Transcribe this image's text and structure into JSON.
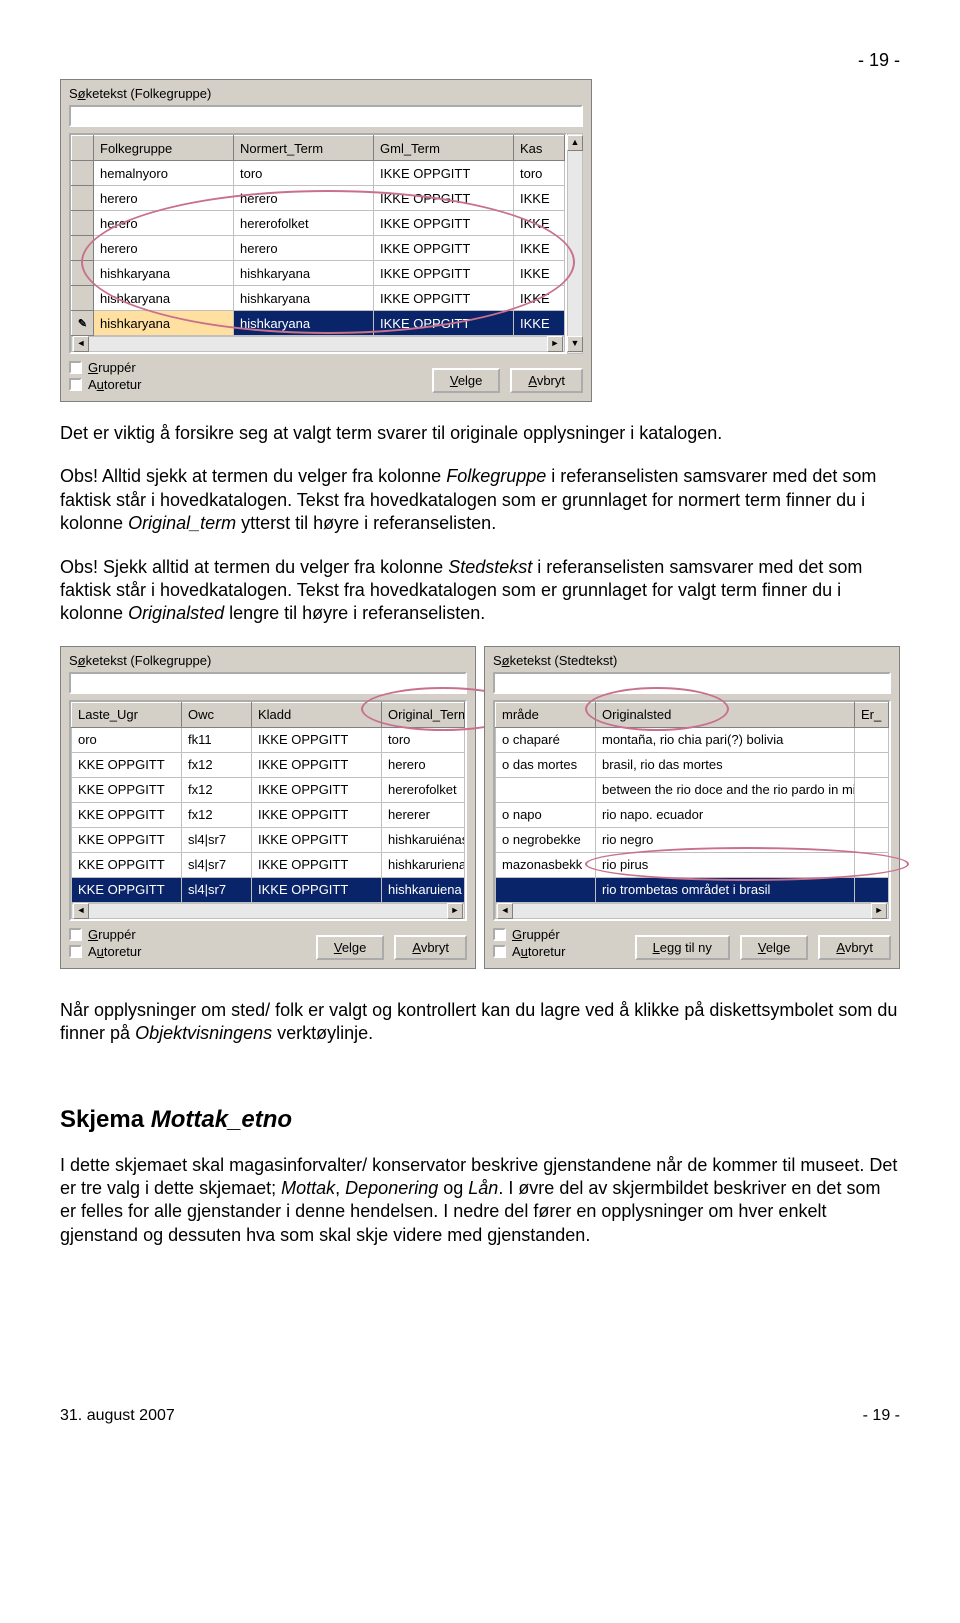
{
  "page": {
    "header_right": "- 19 -",
    "footer_left": "31. august 2007",
    "footer_right": "- 19 -"
  },
  "body": {
    "p1": "Det er viktig å forsikre seg at valgt term svarer til originale opplysninger i katalogen.",
    "p2a": "Obs! Alltid sjekk at termen du velger fra kolonne ",
    "p2_em1": "Folkegruppe",
    "p2b": " i referanselisten samsvarer med det som faktisk står i hovedkatalogen. Tekst fra hovedkatalogen som er grunnlaget for normert term finner du i kolonne ",
    "p2_em2": "Original_term",
    "p2c": " ytterst til høyre i referanselisten.",
    "p3a": "Obs! Sjekk alltid at termen du velger fra kolonne ",
    "p3_em1": "Stedstekst",
    "p3b": " i referanselisten samsvarer med det som faktisk står i hovedkatalogen. Tekst fra hovedkatalogen som er grunnlaget for valgt term finner du i kolonne ",
    "p3_em2": "Originalsted",
    "p3c": " lengre til høyre i referanselisten.",
    "p4a": "Når opplysninger om sted/ folk er valgt og kontrollert kan du lagre ved å klikke på diskettsymbolet som du finner på ",
    "p4_em1": "Objektvisningens",
    "p4b": " verktøylinje.",
    "h2a": "Skjema ",
    "h2_em": "Mottak_etno",
    "p5a": "I dette skjemaet skal magasinforvalter/ konservator beskrive gjenstandene når de kommer til museet. Det er tre valg i dette skjemaet; ",
    "p5_em1": "Mottak",
    "p5b": ", ",
    "p5_em2": "Deponering",
    "p5c": " og ",
    "p5_em3": "Lån",
    "p5d": ". I øvre del av skjermbildet beskriver en det som er felles for alle gjenstander i denne hendelsen. I nedre del fører en opplysninger om hver enkelt gjenstand og dessuten hva som skal skje videre med gjenstanden."
  },
  "panel1": {
    "label_pre": "S",
    "label_u": "ø",
    "label_post": "ketekst (Folkegruppe)",
    "cols": {
      "c1": "Folkegruppe",
      "c2": "Normert_Term",
      "c3": "Gml_Term",
      "c4": "Kas"
    },
    "rows": [
      {
        "c1": "hemalnyoro",
        "c2": "toro",
        "c3": "IKKE OPPGITT",
        "c4": "toro"
      },
      {
        "c1": "herero",
        "c2": "herero",
        "c3": "IKKE OPPGITT",
        "c4": "IKKE"
      },
      {
        "c1": "herero",
        "c2": "hererofolket",
        "c3": "IKKE OPPGITT",
        "c4": "IKKE"
      },
      {
        "c1": "herero",
        "c2": "herero",
        "c3": "IKKE OPPGITT",
        "c4": "IKKE"
      },
      {
        "c1": "hishkaryana",
        "c2": "hishkaryana",
        "c3": "IKKE OPPGITT",
        "c4": "IKKE"
      },
      {
        "c1": "hishkaryana",
        "c2": "hishkaryana",
        "c3": "IKKE OPPGITT",
        "c4": "IKKE"
      },
      {
        "c1": "hishkaryana",
        "c2": "hishkaryana",
        "c3": "IKKE OPPGITT",
        "c4": "IKKE",
        "selected": true,
        "editing": true
      }
    ],
    "grupper_u": "G",
    "grupper_post": "ruppér",
    "autoretur_pre": "A",
    "autoretur_u": "u",
    "autoretur_post": "toretur",
    "btn_velge_u": "V",
    "btn_velge_post": "elge",
    "btn_avbryt_u": "A",
    "btn_avbryt_post": "vbryt"
  },
  "panel2": {
    "label_pre": "S",
    "label_u": "ø",
    "label_post": "ketekst (Folkegruppe)",
    "cols": {
      "c1": "Laste_Ugr",
      "c2": "Owc",
      "c3": "Kladd",
      "c4": "Original_Term"
    },
    "rows": [
      {
        "c1": "oro",
        "c2": "fk11",
        "c3": "IKKE OPPGITT",
        "c4": "toro"
      },
      {
        "c1": "KKE OPPGITT",
        "c2": "fx12",
        "c3": "IKKE OPPGITT",
        "c4": "herero"
      },
      {
        "c1": "KKE OPPGITT",
        "c2": "fx12",
        "c3": "IKKE OPPGITT",
        "c4": "hererofolket"
      },
      {
        "c1": "KKE OPPGITT",
        "c2": "fx12",
        "c3": "IKKE OPPGITT",
        "c4": "hererer"
      },
      {
        "c1": "KKE OPPGITT",
        "c2": "sl4|sr7",
        "c3": "IKKE OPPGITT",
        "c4": "hishkaruiénas"
      },
      {
        "c1": "KKE OPPGITT",
        "c2": "sl4|sr7",
        "c3": "IKKE OPPGITT",
        "c4": "hishkaruriena"
      },
      {
        "c1": "KKE OPPGITT",
        "c2": "sl4|sr7",
        "c3": "IKKE OPPGITT",
        "c4": "hishkaruiena",
        "selected": true
      }
    ],
    "grupper_u": "G",
    "grupper_post": "ruppér",
    "autoretur_pre": "A",
    "autoretur_u": "u",
    "autoretur_post": "toretur",
    "btn_velge_u": "V",
    "btn_velge_post": "elge",
    "btn_avbryt_u": "A",
    "btn_avbryt_post": "vbryt"
  },
  "panel3": {
    "label_pre": "S",
    "label_u": "ø",
    "label_post": "ketekst (Stedtekst)",
    "cols": {
      "c1": "mråde",
      "c2": "Originalsted",
      "c3": "Er_"
    },
    "rows": [
      {
        "c1": "o chaparé",
        "c2": "montaña, rio chia pari(?) bolivia",
        "c3": ""
      },
      {
        "c1": "o das mortes",
        "c2": "brasil, rio das mortes",
        "c3": ""
      },
      {
        "c1": "",
        "c2": "between the rio doce and the rio pardo in minas ge",
        "c3": ""
      },
      {
        "c1": "o napo",
        "c2": "rio napo. ecuador",
        "c3": ""
      },
      {
        "c1": "o negrobekke",
        "c2": "rio negro",
        "c3": ""
      },
      {
        "c1": "mazonasbekk",
        "c2": "rio pirus",
        "c3": ""
      },
      {
        "c1": "",
        "c2": "rio trombetas området i brasil",
        "c3": "",
        "selected": true
      }
    ],
    "grupper_u": "G",
    "grupper_post": "ruppér",
    "autoretur_pre": "A",
    "autoretur_u": "u",
    "autoretur_post": "toretur",
    "btn_legg_u": "L",
    "btn_legg_post": "egg til ny",
    "btn_velge_u": "V",
    "btn_velge_post": "elge",
    "btn_avbryt_u": "A",
    "btn_avbryt_post": "vbryt"
  }
}
